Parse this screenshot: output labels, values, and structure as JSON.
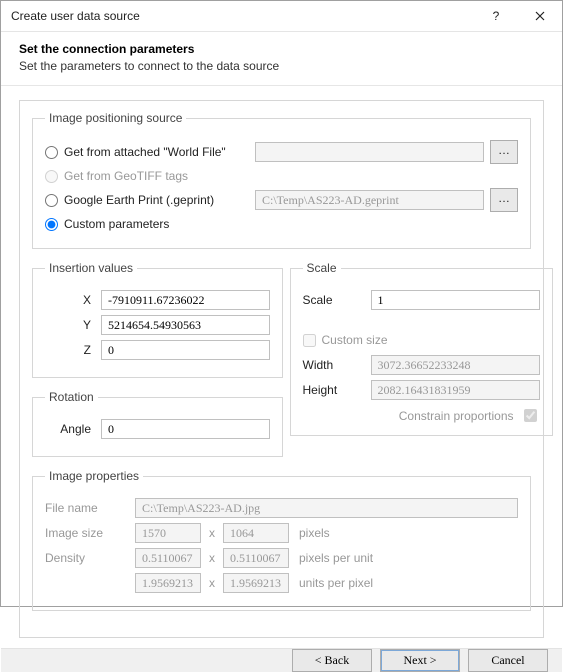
{
  "window": {
    "title": "Create user data source"
  },
  "header": {
    "title": "Set the connection parameters",
    "subtitle": "Set the parameters to connect to the data source"
  },
  "positioning": {
    "legend": "Image positioning source",
    "opt_world": "Get from attached \"World File\"",
    "opt_geotiff": "Get from GeoTIFF tags",
    "opt_geprint": "Google Earth Print (.geprint)",
    "opt_custom": "Custom parameters",
    "world_path": "",
    "geprint_path": "C:\\Temp\\AS223-AD.geprint"
  },
  "insertion": {
    "legend": "Insertion values",
    "x_label": "X",
    "x": "-7910911.67236022",
    "y_label": "Y",
    "y": "5214654.54930563",
    "z_label": "Z",
    "z": "0"
  },
  "rotation": {
    "legend": "Rotation",
    "angle_label": "Angle",
    "angle": "0"
  },
  "scale": {
    "legend": "Scale",
    "scale_label": "Scale",
    "scale": "1",
    "custom_size_label": "Custom size",
    "width_label": "Width",
    "width": "3072.36652233248",
    "height_label": "Height",
    "height": "2082.16431831959",
    "constrain_label": "Constrain proportions"
  },
  "props": {
    "legend": "Image properties",
    "file_label": "File name",
    "file": "C:\\Temp\\AS223-AD.jpg",
    "size_label": "Image size",
    "w": "1570",
    "h": "1064",
    "size_unit": "pixels",
    "density_label": "Density",
    "dx": "0.5110067",
    "dy": "0.5110067",
    "density_unit": "pixels per unit",
    "upx": "1.9569213",
    "upy": "1.9569213",
    "ppxu": "units per pixel",
    "mul": "x"
  },
  "footer": {
    "back": "< Back",
    "next": "Next >",
    "cancel": "Cancel"
  }
}
